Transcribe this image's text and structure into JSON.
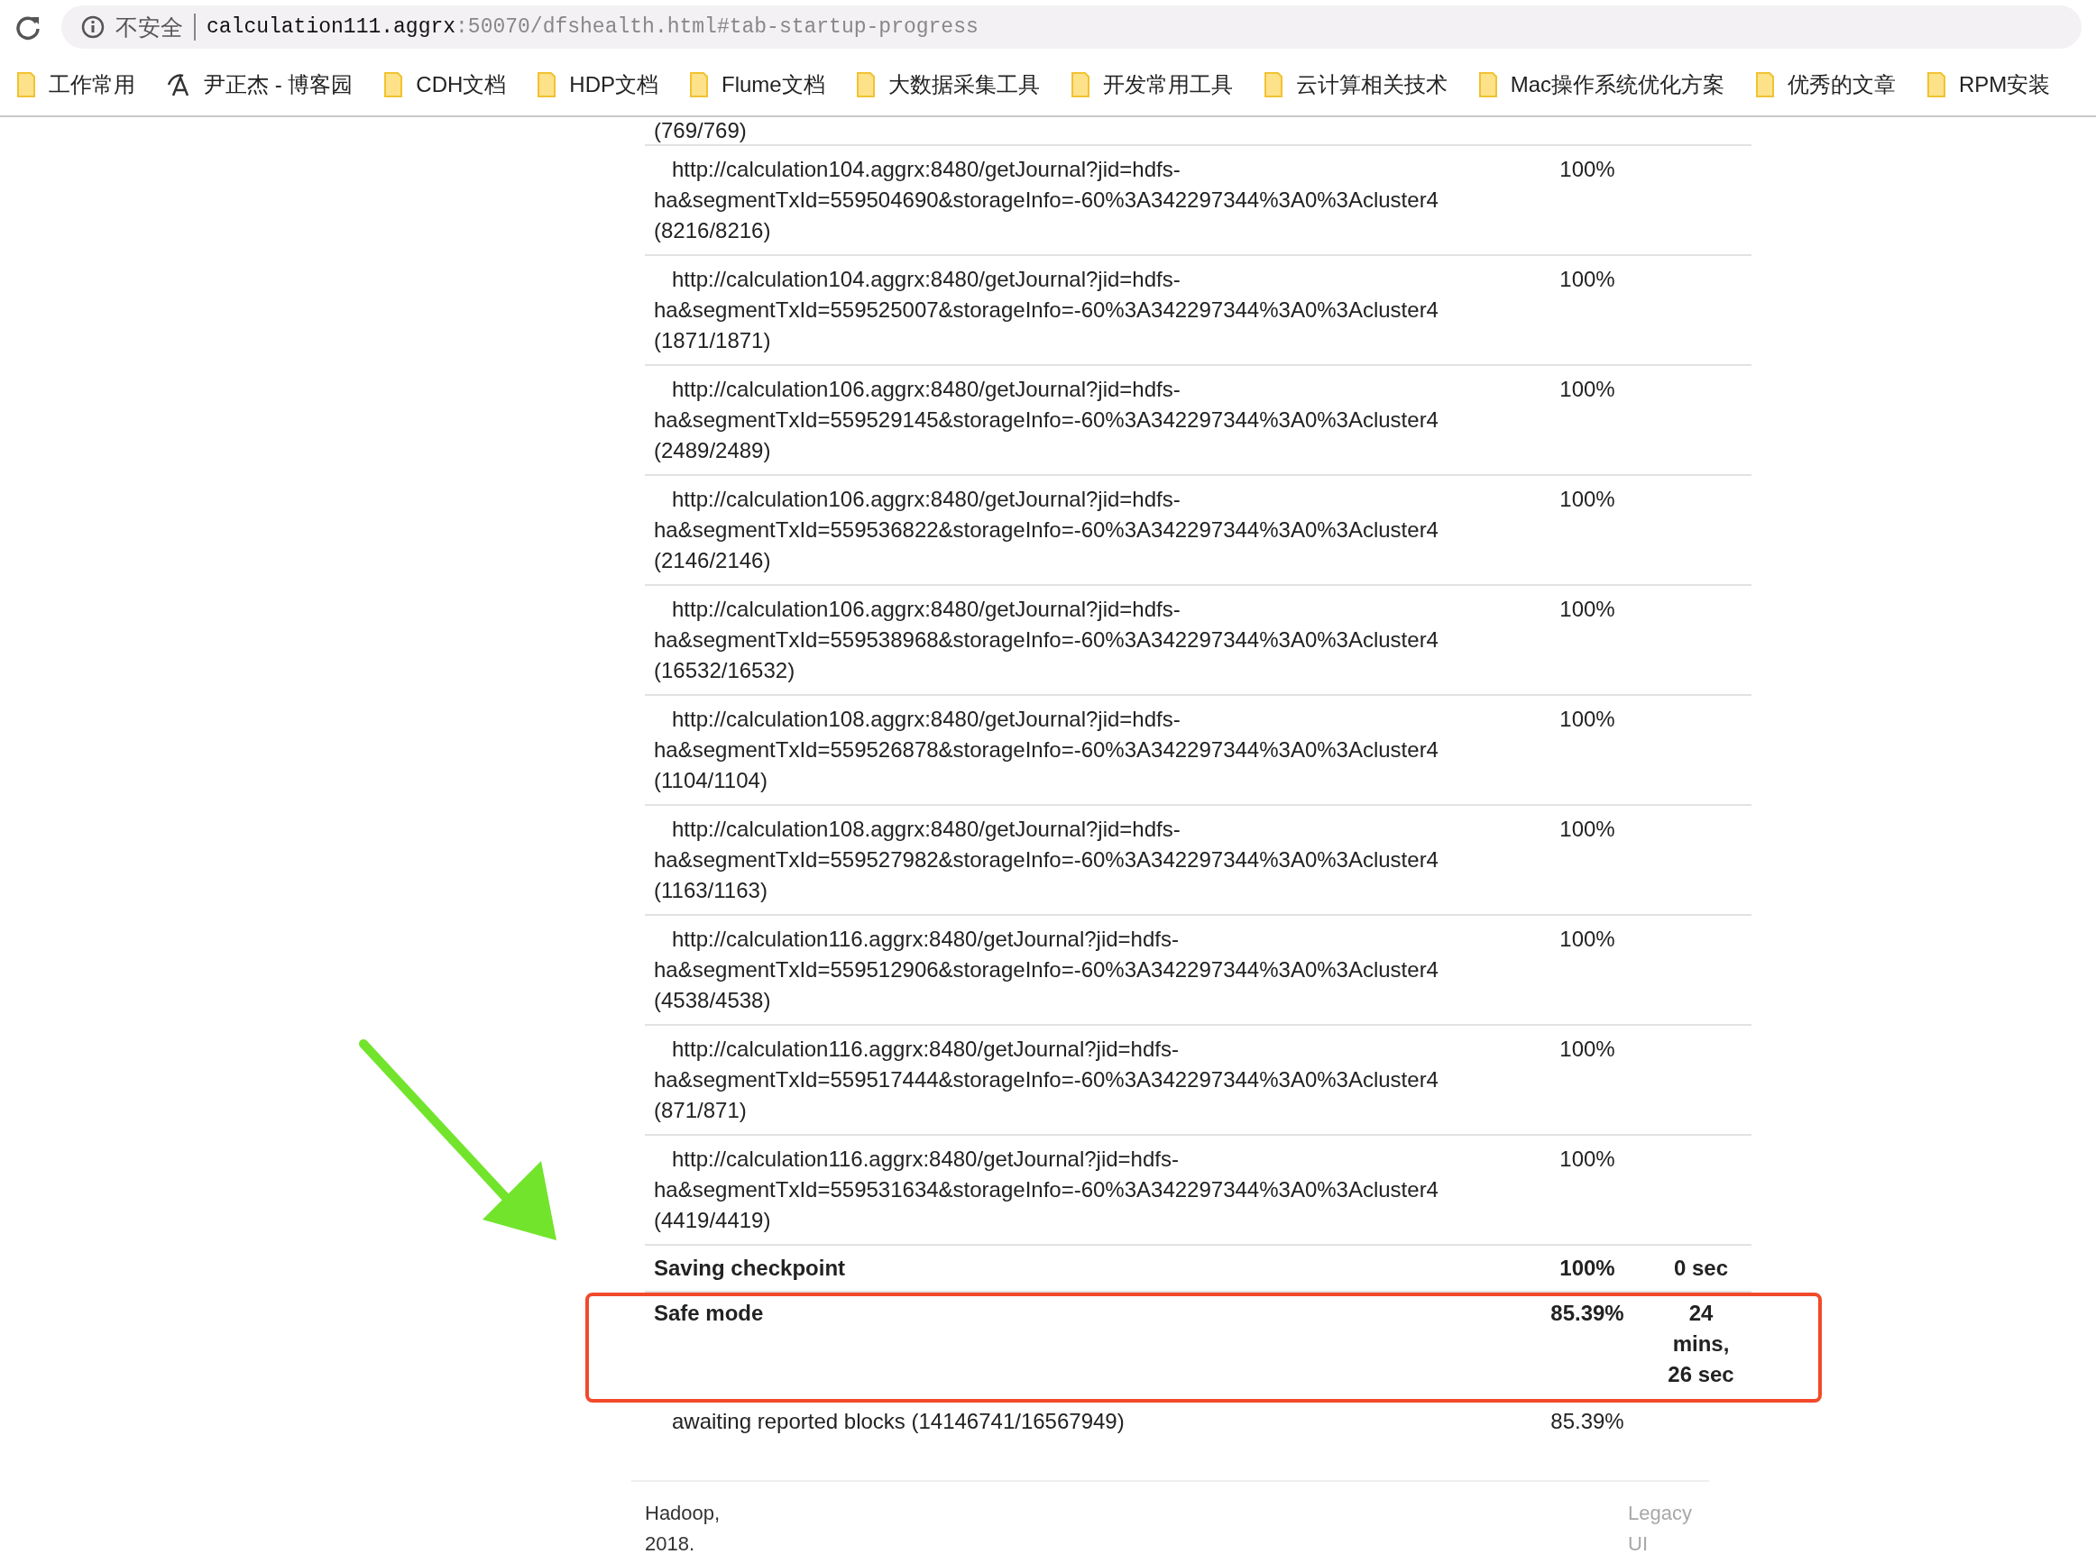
{
  "address_bar": {
    "security_label": "不安全",
    "host": "calculation111.aggrx",
    "path": ":50070/dfshealth.html#tab-startup-progress"
  },
  "bookmarks": [
    {
      "kind": "folder",
      "label": "工作常用"
    },
    {
      "kind": "page",
      "label": "尹正杰 - 博客园"
    },
    {
      "kind": "folder",
      "label": "CDH文档"
    },
    {
      "kind": "folder",
      "label": "HDP文档"
    },
    {
      "kind": "folder",
      "label": "Flume文档"
    },
    {
      "kind": "folder",
      "label": "大数据采集工具"
    },
    {
      "kind": "folder",
      "label": "开发常用工具"
    },
    {
      "kind": "folder",
      "label": "云计算相关技术"
    },
    {
      "kind": "folder",
      "label": "Mac操作系统优化方案"
    },
    {
      "kind": "folder",
      "label": "优秀的文章"
    },
    {
      "kind": "folder",
      "label": "RPM安装"
    }
  ],
  "progress_rows": [
    {
      "kind": "partial",
      "count": "(769/769)"
    },
    {
      "kind": "task",
      "url": "http://calculation104.aggrx:8480/getJournal?jid=hdfs-ha&segmentTxId=559504690&storageInfo=-60%3A342297344%3A0%3Acluster4",
      "count": "(8216/8216)",
      "percent": "100%"
    },
    {
      "kind": "task",
      "url": "http://calculation104.aggrx:8480/getJournal?jid=hdfs-ha&segmentTxId=559525007&storageInfo=-60%3A342297344%3A0%3Acluster4",
      "count": "(1871/1871)",
      "percent": "100%"
    },
    {
      "kind": "task",
      "url": "http://calculation106.aggrx:8480/getJournal?jid=hdfs-ha&segmentTxId=559529145&storageInfo=-60%3A342297344%3A0%3Acluster4",
      "count": "(2489/2489)",
      "percent": "100%"
    },
    {
      "kind": "task",
      "url": "http://calculation106.aggrx:8480/getJournal?jid=hdfs-ha&segmentTxId=559536822&storageInfo=-60%3A342297344%3A0%3Acluster4",
      "count": "(2146/2146)",
      "percent": "100%"
    },
    {
      "kind": "task",
      "url": "http://calculation106.aggrx:8480/getJournal?jid=hdfs-ha&segmentTxId=559538968&storageInfo=-60%3A342297344%3A0%3Acluster4",
      "count": "(16532/16532)",
      "percent": "100%"
    },
    {
      "kind": "task",
      "url": "http://calculation108.aggrx:8480/getJournal?jid=hdfs-ha&segmentTxId=559526878&storageInfo=-60%3A342297344%3A0%3Acluster4",
      "count": "(1104/1104)",
      "percent": "100%"
    },
    {
      "kind": "task",
      "url": "http://calculation108.aggrx:8480/getJournal?jid=hdfs-ha&segmentTxId=559527982&storageInfo=-60%3A342297344%3A0%3Acluster4",
      "count": "(1163/1163)",
      "percent": "100%"
    },
    {
      "kind": "task",
      "url": "http://calculation116.aggrx:8480/getJournal?jid=hdfs-ha&segmentTxId=559512906&storageInfo=-60%3A342297344%3A0%3Acluster4",
      "count": "(4538/4538)",
      "percent": "100%"
    },
    {
      "kind": "task",
      "url": "http://calculation116.aggrx:8480/getJournal?jid=hdfs-ha&segmentTxId=559517444&storageInfo=-60%3A342297344%3A0%3Acluster4",
      "count": "(871/871)",
      "percent": "100%"
    },
    {
      "kind": "task",
      "url": "http://calculation116.aggrx:8480/getJournal?jid=hdfs-ha&segmentTxId=559531634&storageInfo=-60%3A342297344%3A0%3Acluster4",
      "count": "(4419/4419)",
      "percent": "100%"
    },
    {
      "kind": "phase",
      "name": "Saving checkpoint",
      "percent": "100%",
      "elapsed": "0 sec",
      "highlighted": false
    },
    {
      "kind": "phase",
      "name": "Safe mode",
      "percent": "85.39%",
      "elapsed": "24 mins, 26 sec",
      "highlighted": true
    },
    {
      "kind": "status",
      "text": "awaiting reported blocks (14146741/16567949)",
      "percent": "85.39%"
    }
  ],
  "footer": {
    "copyright": "Hadoop, 2018.",
    "link": "Legacy UI"
  }
}
